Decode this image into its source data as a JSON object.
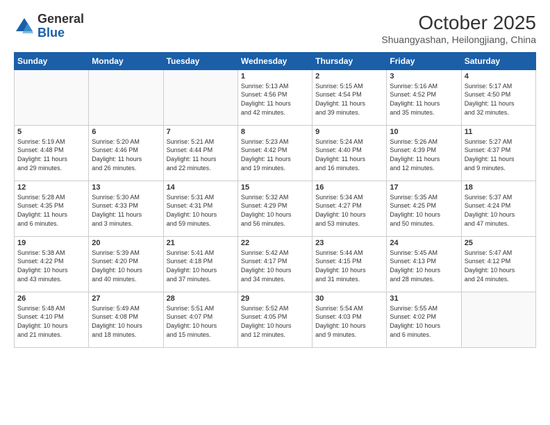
{
  "header": {
    "logo_general": "General",
    "logo_blue": "Blue",
    "title": "October 2025",
    "location": "Shuangyashan, Heilongjiang, China"
  },
  "weekdays": [
    "Sunday",
    "Monday",
    "Tuesday",
    "Wednesday",
    "Thursday",
    "Friday",
    "Saturday"
  ],
  "weeks": [
    [
      {
        "day": "",
        "info": ""
      },
      {
        "day": "",
        "info": ""
      },
      {
        "day": "",
        "info": ""
      },
      {
        "day": "1",
        "info": "Sunrise: 5:13 AM\nSunset: 4:56 PM\nDaylight: 11 hours\nand 42 minutes."
      },
      {
        "day": "2",
        "info": "Sunrise: 5:15 AM\nSunset: 4:54 PM\nDaylight: 11 hours\nand 39 minutes."
      },
      {
        "day": "3",
        "info": "Sunrise: 5:16 AM\nSunset: 4:52 PM\nDaylight: 11 hours\nand 35 minutes."
      },
      {
        "day": "4",
        "info": "Sunrise: 5:17 AM\nSunset: 4:50 PM\nDaylight: 11 hours\nand 32 minutes."
      }
    ],
    [
      {
        "day": "5",
        "info": "Sunrise: 5:19 AM\nSunset: 4:48 PM\nDaylight: 11 hours\nand 29 minutes."
      },
      {
        "day": "6",
        "info": "Sunrise: 5:20 AM\nSunset: 4:46 PM\nDaylight: 11 hours\nand 26 minutes."
      },
      {
        "day": "7",
        "info": "Sunrise: 5:21 AM\nSunset: 4:44 PM\nDaylight: 11 hours\nand 22 minutes."
      },
      {
        "day": "8",
        "info": "Sunrise: 5:23 AM\nSunset: 4:42 PM\nDaylight: 11 hours\nand 19 minutes."
      },
      {
        "day": "9",
        "info": "Sunrise: 5:24 AM\nSunset: 4:40 PM\nDaylight: 11 hours\nand 16 minutes."
      },
      {
        "day": "10",
        "info": "Sunrise: 5:26 AM\nSunset: 4:39 PM\nDaylight: 11 hours\nand 12 minutes."
      },
      {
        "day": "11",
        "info": "Sunrise: 5:27 AM\nSunset: 4:37 PM\nDaylight: 11 hours\nand 9 minutes."
      }
    ],
    [
      {
        "day": "12",
        "info": "Sunrise: 5:28 AM\nSunset: 4:35 PM\nDaylight: 11 hours\nand 6 minutes."
      },
      {
        "day": "13",
        "info": "Sunrise: 5:30 AM\nSunset: 4:33 PM\nDaylight: 11 hours\nand 3 minutes."
      },
      {
        "day": "14",
        "info": "Sunrise: 5:31 AM\nSunset: 4:31 PM\nDaylight: 10 hours\nand 59 minutes."
      },
      {
        "day": "15",
        "info": "Sunrise: 5:32 AM\nSunset: 4:29 PM\nDaylight: 10 hours\nand 56 minutes."
      },
      {
        "day": "16",
        "info": "Sunrise: 5:34 AM\nSunset: 4:27 PM\nDaylight: 10 hours\nand 53 minutes."
      },
      {
        "day": "17",
        "info": "Sunrise: 5:35 AM\nSunset: 4:25 PM\nDaylight: 10 hours\nand 50 minutes."
      },
      {
        "day": "18",
        "info": "Sunrise: 5:37 AM\nSunset: 4:24 PM\nDaylight: 10 hours\nand 47 minutes."
      }
    ],
    [
      {
        "day": "19",
        "info": "Sunrise: 5:38 AM\nSunset: 4:22 PM\nDaylight: 10 hours\nand 43 minutes."
      },
      {
        "day": "20",
        "info": "Sunrise: 5:39 AM\nSunset: 4:20 PM\nDaylight: 10 hours\nand 40 minutes."
      },
      {
        "day": "21",
        "info": "Sunrise: 5:41 AM\nSunset: 4:18 PM\nDaylight: 10 hours\nand 37 minutes."
      },
      {
        "day": "22",
        "info": "Sunrise: 5:42 AM\nSunset: 4:17 PM\nDaylight: 10 hours\nand 34 minutes."
      },
      {
        "day": "23",
        "info": "Sunrise: 5:44 AM\nSunset: 4:15 PM\nDaylight: 10 hours\nand 31 minutes."
      },
      {
        "day": "24",
        "info": "Sunrise: 5:45 AM\nSunset: 4:13 PM\nDaylight: 10 hours\nand 28 minutes."
      },
      {
        "day": "25",
        "info": "Sunrise: 5:47 AM\nSunset: 4:12 PM\nDaylight: 10 hours\nand 24 minutes."
      }
    ],
    [
      {
        "day": "26",
        "info": "Sunrise: 5:48 AM\nSunset: 4:10 PM\nDaylight: 10 hours\nand 21 minutes."
      },
      {
        "day": "27",
        "info": "Sunrise: 5:49 AM\nSunset: 4:08 PM\nDaylight: 10 hours\nand 18 minutes."
      },
      {
        "day": "28",
        "info": "Sunrise: 5:51 AM\nSunset: 4:07 PM\nDaylight: 10 hours\nand 15 minutes."
      },
      {
        "day": "29",
        "info": "Sunrise: 5:52 AM\nSunset: 4:05 PM\nDaylight: 10 hours\nand 12 minutes."
      },
      {
        "day": "30",
        "info": "Sunrise: 5:54 AM\nSunset: 4:03 PM\nDaylight: 10 hours\nand 9 minutes."
      },
      {
        "day": "31",
        "info": "Sunrise: 5:55 AM\nSunset: 4:02 PM\nDaylight: 10 hours\nand 6 minutes."
      },
      {
        "day": "",
        "info": ""
      }
    ]
  ]
}
